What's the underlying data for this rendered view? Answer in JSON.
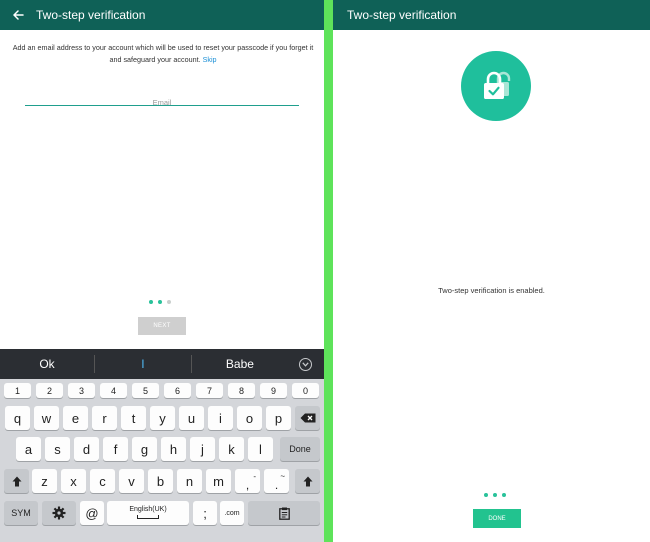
{
  "left_screen": {
    "title": "Two-step verification",
    "back_icon": "arrow-left-icon",
    "intro_text": "Add an email address to your account which will be used to reset your passcode if you forget it and safeguard your account.",
    "skip_label": "Skip",
    "email_placeholder": "Email",
    "email_value": "",
    "progress_steps": 3,
    "progress_current": 2,
    "next_label": "NEXT"
  },
  "keyboard": {
    "suggestions": [
      "Ok",
      "I",
      "Babe"
    ],
    "collapse_icon": "chevron-down-icon",
    "number_row": [
      "1",
      "2",
      "3",
      "4",
      "5",
      "6",
      "7",
      "8",
      "9",
      "0"
    ],
    "row1": [
      "q",
      "w",
      "e",
      "r",
      "t",
      "y",
      "u",
      "i",
      "o",
      "p"
    ],
    "row2": [
      "a",
      "s",
      "d",
      "f",
      "g",
      "h",
      "j",
      "k",
      "l"
    ],
    "row3": [
      "z",
      "x",
      "c",
      "v",
      "b",
      "n",
      "m"
    ],
    "done_label": "Done",
    "sym_label": "SYM",
    "at_label": "@",
    "space_label": "English(UK)",
    "semicolon_label": ";",
    "com_label": ".com",
    "comma_key": ",",
    "period_key": ".",
    "comma_hint": "-",
    "period_hint": "~",
    "icons": {
      "backspace": "backspace-icon",
      "shift": "shift-icon",
      "settings": "gear-icon",
      "clipboard": "clipboard-icon"
    }
  },
  "right_screen": {
    "title": "Two-step verification",
    "lock_icon": "lock-check-icon",
    "message": "Two-step verification is enabled.",
    "progress_steps": 3,
    "done_label": "DONE"
  },
  "colors": {
    "appbar": "#0f6157",
    "accent": "#1fbf9c",
    "separator": "#5ee35a",
    "link": "#1b8fd6",
    "keyboard_bg": "#d4d6da",
    "suggestion_bar": "#2b2e33"
  }
}
